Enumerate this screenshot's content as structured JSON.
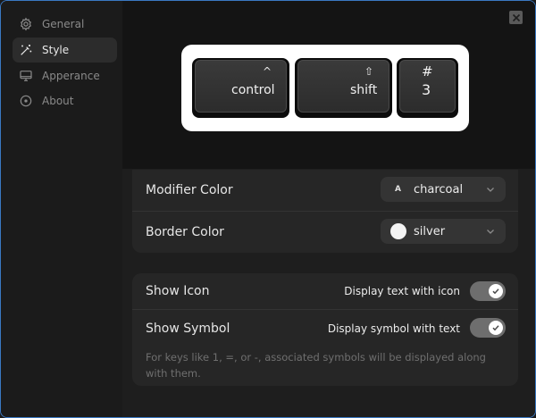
{
  "sidebar": {
    "items": [
      {
        "label": "General",
        "icon": "gear-icon",
        "active": false
      },
      {
        "label": "Style",
        "icon": "magic-wand-icon",
        "active": true
      },
      {
        "label": "Apperance",
        "icon": "monitor-icon",
        "active": false
      },
      {
        "label": "About",
        "icon": "info-circle-icon",
        "active": false
      }
    ]
  },
  "preview": {
    "keys": [
      {
        "symbol": "^",
        "label": "control"
      },
      {
        "symbol": "⇧",
        "label": "shift"
      },
      {
        "symbol": "#",
        "label": "3"
      }
    ]
  },
  "colors": {
    "modifier": {
      "label": "Modifier Color",
      "value": "charcoal",
      "swatch": "A"
    },
    "border": {
      "label": "Border Color",
      "value": "silver",
      "swatch_color": "#f4f4f4"
    }
  },
  "display": {
    "show_icon": {
      "label": "Show Icon",
      "description": "Display text with icon",
      "enabled": true
    },
    "show_symbol": {
      "label": "Show Symbol",
      "description": "Display symbol with text",
      "enabled": true
    },
    "note": "For keys like 1, =, or -, associated symbols will be displayed along with them."
  },
  "theme": {
    "accent_border": "#3a78c2",
    "toggle_on": "#6e6e6e"
  }
}
